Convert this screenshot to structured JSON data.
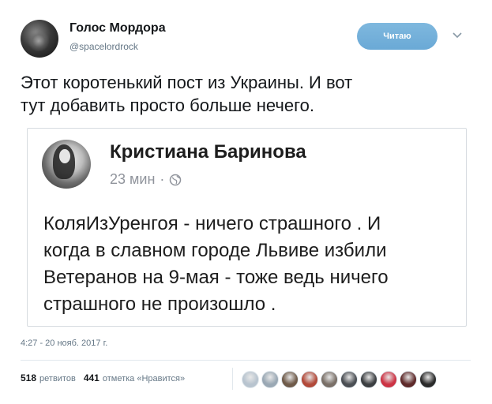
{
  "tweet": {
    "display_name": "Голос Мордора",
    "handle": "@spacelordrock",
    "follow_label": "Читаю",
    "text_lines": [
      "Этот коротенький пост из Украины. И вот",
      "тут добавить просто больше нечего."
    ],
    "timestamp": "4:27 - 20 нояб. 2017 г.",
    "retweets_count": "518",
    "retweets_label": "ретвитов",
    "likes_count": "441",
    "likes_label": "отметка «Нравится»"
  },
  "embedded_post": {
    "author": "Кристиана Баринова",
    "time": "23 мин",
    "separator": "·",
    "audience_icon": "globe-icon",
    "text_lines": [
      "КоляИзУренгоя - ничего страшного . И",
      "когда в славном городе Львиве избили",
      "Ветеранов на 9-мая - тоже ведь ничего",
      "страшного не произошло ."
    ]
  },
  "likers": [
    {
      "icon": "default-avatar",
      "color": "#b8c4cf"
    },
    {
      "icon": "default-avatar",
      "color": "#9aa8b4"
    },
    {
      "icon": "user-avatar",
      "color": "#6f5b4a"
    },
    {
      "icon": "user-avatar",
      "color": "#b24a3a"
    },
    {
      "icon": "user-avatar",
      "color": "#7a7068"
    },
    {
      "icon": "user-avatar",
      "color": "#4b4f54"
    },
    {
      "icon": "user-avatar",
      "color": "#3c3f42"
    },
    {
      "icon": "user-avatar",
      "color": "#cc3344"
    },
    {
      "icon": "user-avatar",
      "color": "#5e2a2a"
    },
    {
      "icon": "user-avatar",
      "color": "#2b2b2b"
    }
  ],
  "colors": {
    "follow_button": "#6aa9d6",
    "secondary_text": "#657786",
    "embed_meta": "#90949c"
  }
}
